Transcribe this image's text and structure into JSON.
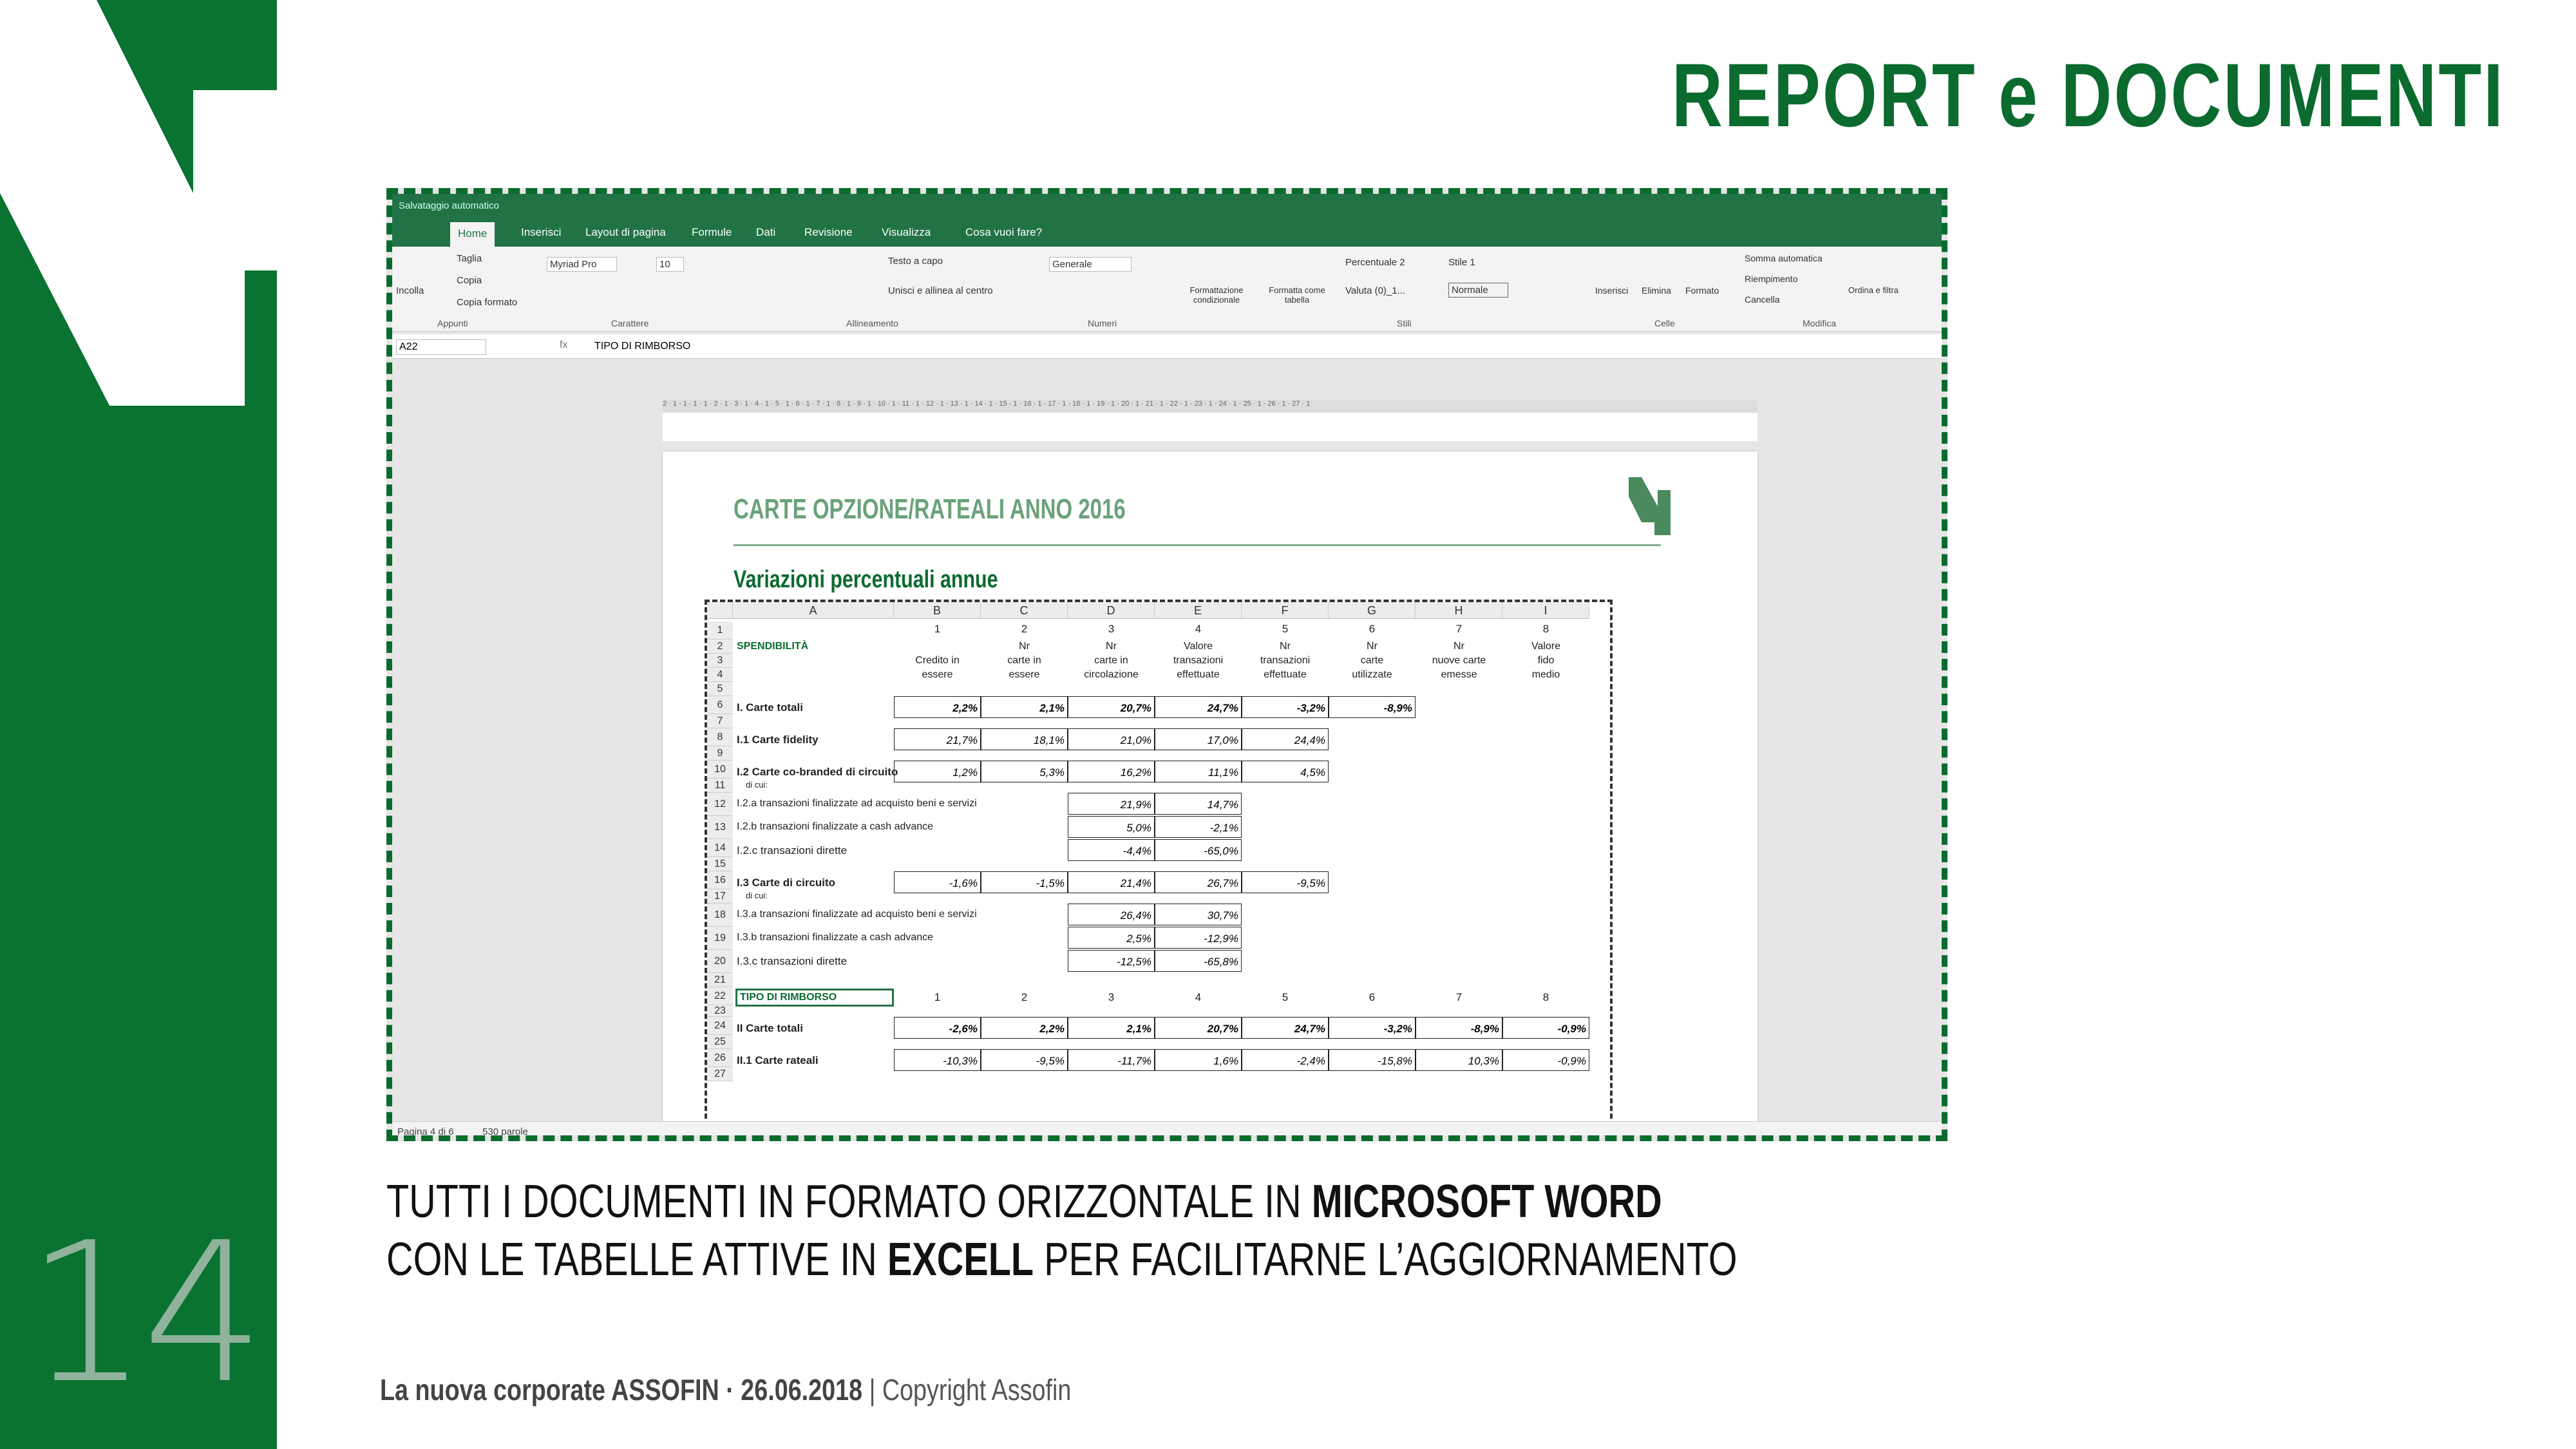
{
  "slide": {
    "title": "REPORT e DOCUMENTI",
    "page_number": "14",
    "caption_line1_pre": "TUTTI I DOCUMENTI IN FORMATO ORIZZONTALE ",
    "caption_line1_mid": "IN ",
    "caption_line1_bold": "MICROSOFT WORD",
    "caption_line2_pre": "CON LE TABELLE ATTIVE IN ",
    "caption_line2_bold": "EXCELL",
    "caption_line2_post": " PER FACILITARNE L’AGGIORNAMENTO",
    "footer_bold": "La nuova corporate ASSOFIN · 26.06.2018",
    "footer_rest": " | Copyright Assofin",
    "brand_color": "#0b7332"
  },
  "word": {
    "autosave": "Salvataggio automatico",
    "tabs": [
      "Home",
      "Inserisci",
      "Layout di pagina",
      "Formule",
      "Dati",
      "Revisione",
      "Visualizza",
      "Cosa vuoi fare?"
    ],
    "clipboard": {
      "paste": "Incolla",
      "cut": "Taglia",
      "copy": "Copia",
      "format": "Copia formato",
      "group": "Appunti"
    },
    "font": {
      "name": "Myriad Pro",
      "size": "10",
      "group": "Carattere"
    },
    "align": {
      "wrap": "Testo a capo",
      "merge": "Unisci e allinea al centro",
      "group": "Allineamento"
    },
    "number": {
      "format": "Generale",
      "group": "Numeri"
    },
    "styles": {
      "cond": "Formattazione condizionale",
      "table": "Formatta come tabella",
      "s1": "Percentuale 2",
      "s2": "Stile 1",
      "s3": "Valuta (0)_1...",
      "s4": "Normale",
      "group": "Stili"
    },
    "cells": {
      "insert": "Inserisci",
      "delete": "Elimina",
      "format": "Formato",
      "group": "Celle"
    },
    "edit": {
      "sum": "Somma automatica",
      "fill": "Riempimento",
      "clear": "Cancella",
      "sort": "Ordina e filtra",
      "group": "Modifica"
    },
    "namebox": "A22",
    "formula": "TIPO DI RIMBORSO",
    "ruler": "2 · 1 · 1 · 1 · 1 · 2 · 1 · 3 · 1 · 4 · 1 · 5 · 1 · 6 · 1 · 7 · 1 · 8 · 1 · 9 · 1 · 10 · 1 · 11 · 1 · 12 · 1 · 13 · 1 · 14 · 1 · 15 · 1 · 16 · 1 · 17 · 1 · 18 · 1 · 19 · 1 · 20 · 1 · 21 · 1 · 22 · 1 · 23 · 1 · 24 · 1 · 25 · 1 · 26 · 1 · 27 · 1",
    "status": {
      "page": "Pagina 4 di 6",
      "words": "530 parole"
    }
  },
  "doc": {
    "title": "CARTE OPZIONE/RATEALI ANNO 2016",
    "subtitle": "Variazioni percentuali annue",
    "cols": [
      "A",
      "B",
      "C",
      "D",
      "E",
      "F",
      "G",
      "H",
      "I"
    ],
    "colnums": [
      "1",
      "2",
      "3",
      "4",
      "5",
      "6",
      "7",
      "8"
    ],
    "spendibilita": "SPENDIBILITÀ",
    "col_heads": [
      [
        "",
        "Credito in",
        "essere"
      ],
      [
        "Nr",
        "carte in",
        "essere"
      ],
      [
        "Nr",
        "carte in",
        "circolazione"
      ],
      [
        "Valore",
        "transazioni",
        "effettuate"
      ],
      [
        "Nr",
        "transazioni",
        "effettuate"
      ],
      [
        "Nr",
        "carte",
        "utilizzate"
      ],
      [
        "Nr",
        "nuove carte",
        "emesse"
      ],
      [
        "Valore",
        "fido",
        "medio"
      ]
    ],
    "rows": [
      {
        "r": "6",
        "label": "I. Carte totali",
        "bold": true,
        "vals": [
          "2,2%",
          "2,1%",
          "20,7%",
          "24,7%",
          "-3,2%",
          "-8,9%"
        ],
        "start": 1
      },
      {
        "r": "8",
        "label": "I.1  Carte fidelity",
        "bold": false,
        "vals": [
          "21,7%",
          "18,1%",
          "21,0%",
          "17,0%",
          "24,4%"
        ],
        "start": 1
      },
      {
        "r": "10",
        "label": "I.2  Carte co-branded di circuito",
        "bold": false,
        "vals": [
          "1,2%",
          "5,3%",
          "16,2%",
          "11,1%",
          "4,5%"
        ],
        "start": 1
      },
      {
        "r": "12",
        "label": "I.2.a transazioni finalizzate ad acquisto beni e servizi",
        "bold": false,
        "vals": [
          "21,9%",
          "14,7%"
        ],
        "start": 3
      },
      {
        "r": "13",
        "label": "I.2.b  transazioni finalizzate a cash advance",
        "bold": false,
        "vals": [
          "5,0%",
          "-2,1%"
        ],
        "start": 3
      },
      {
        "r": "14",
        "label": "I.2.c  transazioni dirette",
        "bold": false,
        "vals": [
          "-4,4%",
          "-65,0%"
        ],
        "start": 3
      },
      {
        "r": "16",
        "label": "I.3  Carte di circuito",
        "bold": false,
        "vals": [
          "-1,6%",
          "-1,5%",
          "21,4%",
          "26,7%",
          "-9,5%"
        ],
        "start": 1
      },
      {
        "r": "18",
        "label": "I.3.a  transazioni finalizzate ad acquisto beni e servizi",
        "bold": false,
        "vals": [
          "26,4%",
          "30,7%"
        ],
        "start": 3
      },
      {
        "r": "19",
        "label": "I.3.b  transazioni finalizzate a cash advance",
        "bold": false,
        "vals": [
          "2,5%",
          "-12,9%"
        ],
        "start": 3
      },
      {
        "r": "20",
        "label": "I.3.c  transazioni dirette",
        "bold": false,
        "vals": [
          "-12,5%",
          "-65,8%"
        ],
        "start": 3
      }
    ],
    "dicui": "di cui:",
    "rimborso": "TIPO DI RIMBORSO",
    "rows2": [
      {
        "r": "24",
        "label": "II  Carte totali",
        "bold": true,
        "vals": [
          "-2,6%",
          "2,2%",
          "2,1%",
          "20,7%",
          "24,7%",
          "-3,2%",
          "-8,9%",
          "-0,9%"
        ]
      },
      {
        "r": "26",
        "label": "II.1 Carte rateali",
        "bold": false,
        "vals": [
          "-10,3%",
          "-9,5%",
          "-11,7%",
          "1,6%",
          "-2,4%",
          "-15,8%",
          "10,3%",
          "-0,9%"
        ]
      }
    ]
  }
}
